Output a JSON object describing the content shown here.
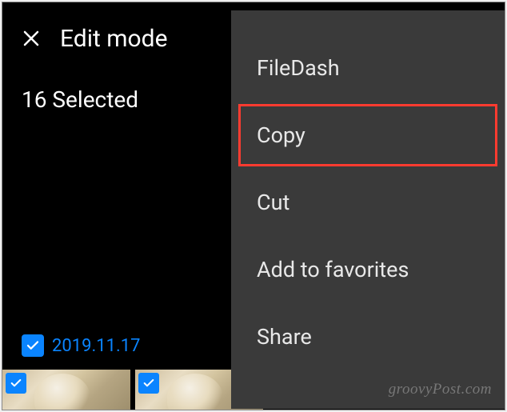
{
  "header": {
    "title": "Edit mode"
  },
  "selection": {
    "count_label": "16 Selected"
  },
  "date_group": {
    "label": "2019.11.17",
    "checked": true
  },
  "context_menu": {
    "items": [
      {
        "label": "FileDash",
        "highlighted": false
      },
      {
        "label": "Copy",
        "highlighted": true
      },
      {
        "label": "Cut",
        "highlighted": false
      },
      {
        "label": "Add to favorites",
        "highlighted": false
      },
      {
        "label": "Share",
        "highlighted": false
      }
    ]
  },
  "watermark": "groovyPost.com"
}
